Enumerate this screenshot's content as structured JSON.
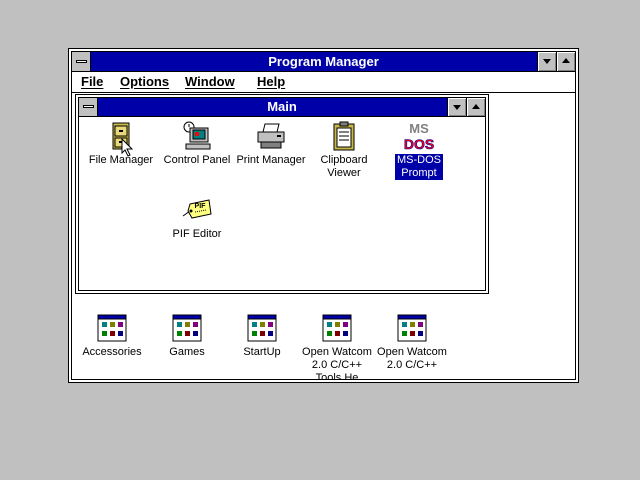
{
  "window": {
    "title": "Program Manager"
  },
  "menu": {
    "file": "File",
    "options": "Options",
    "window": "Window",
    "help": "Help"
  },
  "main_group": {
    "title": "Main",
    "icons": [
      {
        "label": "File Manager",
        "icon": "file-cabinet-icon"
      },
      {
        "label": "Control Panel",
        "icon": "control-panel-icon"
      },
      {
        "label": "Print Manager",
        "icon": "printer-icon"
      },
      {
        "label_line1": "Clipboard",
        "label_line2": "Viewer",
        "icon": "clipboard-icon"
      },
      {
        "label_line1": "MS-DOS",
        "label_line2": "Prompt",
        "icon": "ms-dos-icon",
        "selected": true
      },
      {
        "label": "PIF Editor",
        "icon": "pif-tag-icon",
        "icon_text": "PIF"
      }
    ]
  },
  "groups": [
    {
      "label": "Accessories",
      "icon": "program-group-icon"
    },
    {
      "label": "Games",
      "icon": "program-group-icon"
    },
    {
      "label": "StartUp",
      "icon": "program-group-icon"
    },
    {
      "label_line1": "Open Watcom",
      "label_line2": "2.0 C/C++",
      "label_line3": "Tools He",
      "icon": "program-group-icon"
    },
    {
      "label_line1": "Open Watcom",
      "label_line2": "2.0 C/C++",
      "icon": "program-group-icon"
    }
  ],
  "msdos_icon_text": {
    "line1": "MS",
    "line2": "DOS"
  },
  "colors": {
    "titlebar": "#0000a8",
    "desktop": "#c0c0c0",
    "selection": "#0000a8"
  }
}
